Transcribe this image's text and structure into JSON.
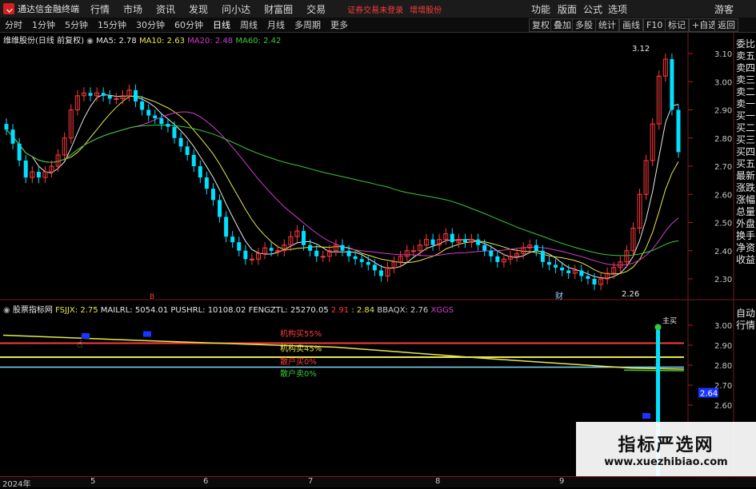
{
  "app": {
    "title": "通达信金融终端"
  },
  "menu": [
    "行情",
    "市场",
    "资讯",
    "发现",
    "问小达",
    "财富圈",
    "交易"
  ],
  "warnings": [
    "证券交易未登录",
    "增增股份"
  ],
  "right_menu": [
    "功能",
    "版面",
    "公式",
    "选项",
    "游客"
  ],
  "periods": [
    "分时",
    "1分钟",
    "5分钟",
    "15分钟",
    "30分钟",
    "60分钟",
    "日线",
    "周线",
    "月线",
    "多周期",
    "更多"
  ],
  "period_active": "日线",
  "right_tools": [
    "复权",
    "叠加",
    "多股",
    "统计",
    "画线",
    "F10",
    "标记",
    "+自选",
    "返回"
  ],
  "stock": {
    "name": "维维股份(日线 前复权)",
    "ma": [
      {
        "label": "MA5: 2.78",
        "color": "#e8e8e8"
      },
      {
        "label": "MA10: 2.63",
        "color": "#e8e84a"
      },
      {
        "label": "MA20: 2.48",
        "color": "#d23bd2"
      },
      {
        "label": "MA60: 2.42",
        "color": "#39c839"
      }
    ],
    "high_label": "3.12",
    "low_label": "2.26",
    "cai_label": "财",
    "b_marker": "B"
  },
  "price_axis": [
    "3.10",
    "3.00",
    "2.90",
    "2.80",
    "2.70",
    "2.60",
    "2.50",
    "2.40",
    "2.30"
  ],
  "indicator": {
    "name": "股票指标网",
    "items": [
      {
        "label": "FSJJX: 2.75",
        "color": "#e8e84a"
      },
      {
        "label": "MAILRL: 5054.01",
        "color": "#e8e8e8"
      },
      {
        "label": "PUSHRL: 10108.02",
        "color": "#e8e8e8"
      },
      {
        "label": "FENGZTL: 25270.05",
        "color": "#e8e8e8"
      },
      {
        "label": "2.91",
        "color": "#ff3b3b"
      },
      {
        "label": ": 2.84",
        "color": "#e8e84a"
      },
      {
        "label": "BBAQX: 2.76",
        "color": "#d0d0d0"
      },
      {
        "label": "XGGS",
        "color": "#d23bd2"
      }
    ],
    "levels": [
      {
        "label": "机构买55%",
        "color": "#ff3b3b"
      },
      {
        "label": "机构卖45%",
        "color": "#e8e84a"
      },
      {
        "label": "散户买0%",
        "color": "#ff3b3b"
      },
      {
        "label": "散户卖0%",
        "color": "#39c839"
      }
    ],
    "axis": [
      "3.00",
      "2.90",
      "2.80",
      "2.70",
      "2.60"
    ],
    "current": "2.64",
    "tag": "主买"
  },
  "side_panel_top": [
    "委比",
    "卖五",
    "卖四",
    "卖三",
    "卖二",
    "卖一",
    "买一",
    "买二",
    "买三",
    "买四",
    "买五",
    "最新",
    "涨跌",
    "涨幅",
    "总量",
    "外盘",
    "换手",
    "净资",
    "收益"
  ],
  "side_panel_bottom": [
    "自动",
    "行情"
  ],
  "dates": [
    "2024年",
    "5",
    "6",
    "7",
    "8",
    "9"
  ],
  "watermark": {
    "title": "指标严选网",
    "url": "www.xuezhibiao.com"
  },
  "colors": {
    "up": "#ff3b3b",
    "down": "#00e0ff",
    "ma5": "#e8e8e8",
    "ma10": "#e8e84a",
    "ma20": "#d23bd2",
    "ma60": "#39c839"
  }
}
